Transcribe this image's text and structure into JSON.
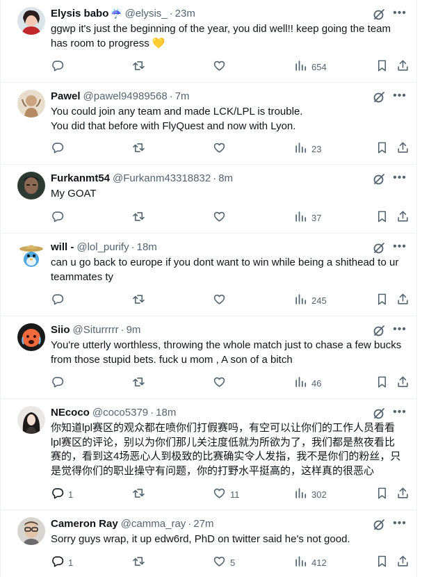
{
  "tweets": [
    {
      "name": "Elysis babo",
      "emoji": "☔",
      "handle": "@elysis_",
      "time": "23m",
      "text": [
        "ggwp it's just the beginning of the year, you did well!! keep going the team has room to progress 💛"
      ],
      "replies": "",
      "retweets": "",
      "likes": "",
      "views": "654"
    },
    {
      "name": "Pawel",
      "emoji": "",
      "handle": "@pawel94989568",
      "time": "7m",
      "text": [
        "You could join any team and made LCK/LPL is trouble.",
        "You did that before with FlyQuest and now with Lyon."
      ],
      "replies": "",
      "retweets": "",
      "likes": "",
      "views": "23"
    },
    {
      "name": "Furkanmt54",
      "emoji": "",
      "handle": "@Furkanm43318832",
      "time": "8m",
      "text": [
        "My GOAT"
      ],
      "replies": "",
      "retweets": "",
      "likes": "",
      "views": "37"
    },
    {
      "name": "will -",
      "emoji": "",
      "handle": "@lol_purify",
      "time": "18m",
      "text": [
        "can u go back to europe if you dont want to win while being a shithead to ur teammates ty"
      ],
      "replies": "",
      "retweets": "",
      "likes": "",
      "views": "245"
    },
    {
      "name": "Siio",
      "emoji": "",
      "handle": "@Siturrrrr",
      "time": "9m",
      "text": [
        "You're utterly worthless, throwing the whole match just to chase a few bucks from those stupid bets. fuck u mom , A son of a bitch"
      ],
      "replies": "",
      "retweets": "",
      "likes": "",
      "views": "46"
    },
    {
      "name": "NEcoco",
      "emoji": "",
      "handle": "@coco5379",
      "time": "18m",
      "text": [
        "你知道lpl赛区的观众都在喷你们打假赛吗，有空可以让你们的工作人员看看lpl赛区的评论，别以为你们那儿关注度低就为所欲为了，我们都是熬夜看比赛的，看到这4场恶心人到极致的比赛确实令人发指，我不是你们的粉丝，只是觉得你们的职业操守有问题，你的打野水平挺高的，这样真的很恶心"
      ],
      "replies": "1",
      "retweets": "",
      "likes": "11",
      "views": "302"
    },
    {
      "name": "Cameron Ray",
      "emoji": "",
      "handle": "@camma_ray",
      "time": "27m",
      "text": [
        "Sorry guys wrap, it up edw6rd, PhD on twitter said he's not good."
      ],
      "replies": "1",
      "retweets": "",
      "likes": "5",
      "views": "412"
    }
  ],
  "colors": {
    "text": "#0f1419",
    "secondary": "#536471",
    "divider": "#eff3f4"
  },
  "icons": [
    "reply-icon",
    "retweet-icon",
    "like-icon",
    "views-icon",
    "bookmark-icon",
    "share-icon",
    "grok-icon",
    "more-icon"
  ]
}
